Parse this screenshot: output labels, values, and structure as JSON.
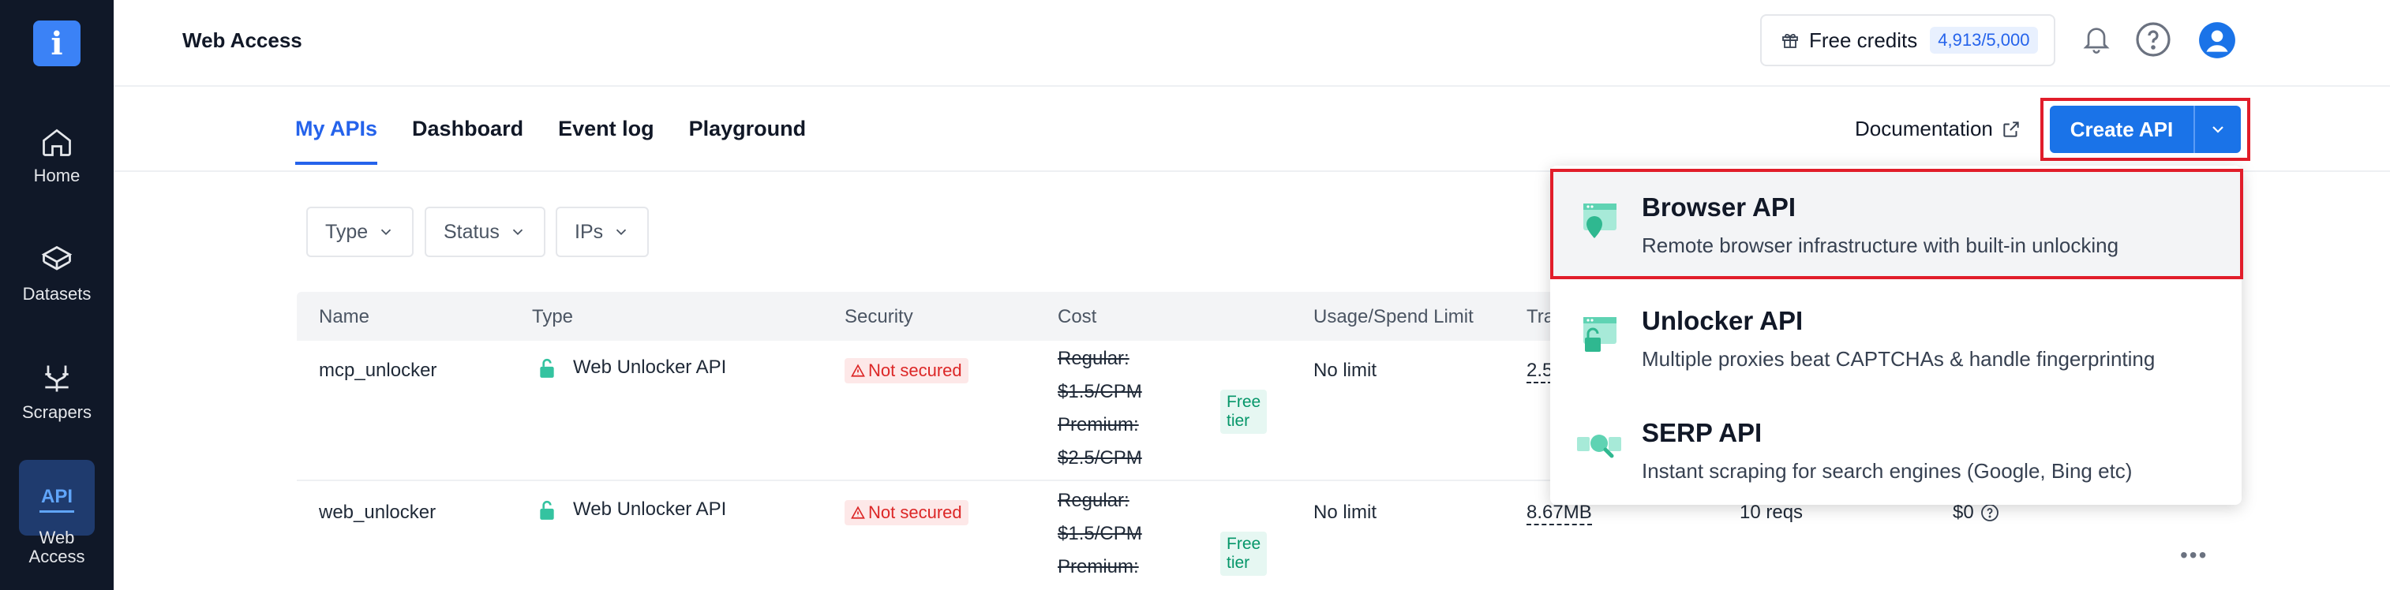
{
  "sidebar": {
    "logo": "i",
    "items": [
      {
        "label": "Home",
        "icon": "home-icon"
      },
      {
        "label": "Datasets",
        "icon": "layers-icon"
      },
      {
        "label": "Scrapers",
        "icon": "scraper-icon"
      },
      {
        "label": "Web\nAccess",
        "icon": "api-icon",
        "icon_text": "API"
      }
    ]
  },
  "header": {
    "title": "Web Access",
    "credits_label": "Free credits",
    "credits_value": "4,913/5,000"
  },
  "tabs": [
    {
      "label": "My APIs",
      "active": true
    },
    {
      "label": "Dashboard",
      "active": false
    },
    {
      "label": "Event log",
      "active": false
    },
    {
      "label": "Playground",
      "active": false
    }
  ],
  "toolbar": {
    "documentation": "Documentation",
    "create_api": "Create API"
  },
  "filters": [
    {
      "label": "Type"
    },
    {
      "label": "Status"
    },
    {
      "label": "IPs"
    }
  ],
  "table": {
    "columns": [
      "Name",
      "Type",
      "Security",
      "Cost",
      "Usage/Spend Limit",
      "Tra"
    ],
    "rows": [
      {
        "name": "mcp_unlocker",
        "type": "Web Unlocker API",
        "security": "Not secured",
        "cost_lines": [
          "Regular:",
          "$1.5/CPM",
          "Premium:",
          "$2.5/CPM"
        ],
        "free_tier": "Free\ntier",
        "limit": "No limit",
        "traffic": "2.5"
      },
      {
        "name": "web_unlocker",
        "type": "Web Unlocker API",
        "security": "Not secured",
        "cost_lines": [
          "Regular:",
          "$1.5/CPM",
          "Premium:"
        ],
        "free_tier": "Free\ntier",
        "limit": "No limit",
        "traffic": "8.67MB",
        "requests": "10 reqs",
        "spend": "$0"
      }
    ]
  },
  "dropdown": {
    "items": [
      {
        "title": "Browser API",
        "desc": "Remote browser infrastructure with built-in unlocking"
      },
      {
        "title": "Unlocker API",
        "desc": "Multiple proxies beat CAPTCHAs & handle fingerprinting"
      },
      {
        "title": "SERP API",
        "desc": "Instant scraping for search engines (Google, Bing etc)"
      }
    ]
  },
  "colors": {
    "sidebar_bg": "#101828",
    "accent": "#1a73e8",
    "highlight_outline": "#e11d2a",
    "teal": "#5fd3b3"
  }
}
